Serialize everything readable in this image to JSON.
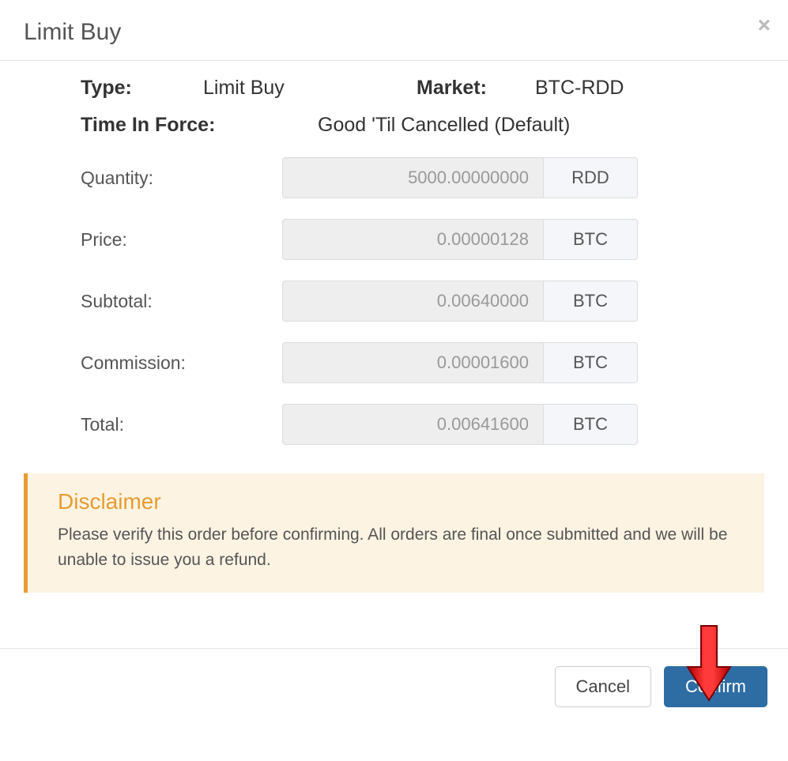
{
  "modal": {
    "title": "Limit Buy",
    "close_label": "×"
  },
  "summary": {
    "type_label": "Type:",
    "type_value": "Limit Buy",
    "market_label": "Market:",
    "market_value": "BTC-RDD",
    "tif_label": "Time In Force:",
    "tif_value": "Good 'Til Cancelled (Default)"
  },
  "fields": {
    "quantity": {
      "label": "Quantity:",
      "value": "5000.00000000",
      "unit": "RDD"
    },
    "price": {
      "label": "Price:",
      "value": "0.00000128",
      "unit": "BTC"
    },
    "subtotal": {
      "label": "Subtotal:",
      "value": "0.00640000",
      "unit": "BTC"
    },
    "commission": {
      "label": "Commission:",
      "value": "0.00001600",
      "unit": "BTC"
    },
    "total": {
      "label": "Total:",
      "value": "0.00641600",
      "unit": "BTC"
    }
  },
  "disclaimer": {
    "heading": "Disclaimer",
    "body": "Please verify this order before confirming. All orders are final once submitted and we will be unable to issue you a refund."
  },
  "footer": {
    "cancel": "Cancel",
    "confirm": "Confirm"
  },
  "annotation": {
    "arrow_color": "#d90000"
  }
}
